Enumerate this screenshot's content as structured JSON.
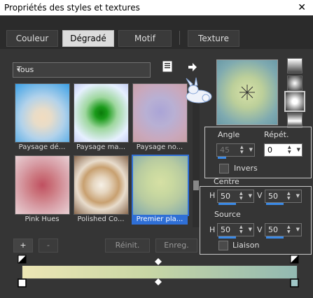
{
  "window": {
    "title": "Propriétés des styles et textures",
    "close": "✕"
  },
  "tabs": [
    "Couleur",
    "Dégradé",
    "Motif",
    "Texture"
  ],
  "dropdown": {
    "value": "Tous",
    "arrow": "▾"
  },
  "thumbnails": [
    {
      "label": "Paysage dé...",
      "colors": [
        "#f1dcc0",
        "#b2d2ea",
        "#3aa0e6"
      ]
    },
    {
      "label": "Paysage ma...",
      "colors": [
        "#118811",
        "#9ed79e",
        "#e6f0ff"
      ]
    },
    {
      "label": "Paysage no...",
      "colors": [
        "#aaa4d6",
        "#c0b0cc",
        "#c9a0a6"
      ]
    },
    {
      "label": "Pink Hues",
      "colors": [
        "#c05060",
        "#d8a0a8",
        "#e8d0d4"
      ]
    },
    {
      "label": "Polished Co...",
      "colors": [
        "#f6f0e6",
        "#c8a070",
        "#8a6a50"
      ]
    },
    {
      "label": "Premier pla...",
      "colors": [
        "#d6e0a4",
        "#b8cba0",
        "#7fa8ae"
      ]
    }
  ],
  "list_buttons": {
    "add": "+",
    "remove": "-",
    "reset": "Réinit.",
    "save": "Enreg."
  },
  "angle": {
    "label": "Angle",
    "value": "45"
  },
  "repeat": {
    "label": "Répét.",
    "value": "0"
  },
  "invert": {
    "label": "Invers"
  },
  "centre": {
    "label": "Centre",
    "h_label": "H",
    "h": "50",
    "v_label": "V",
    "v": "50"
  },
  "source": {
    "label": "Source",
    "h_label": "H",
    "h": "50",
    "v_label": "V",
    "v": "50"
  },
  "link": {
    "label": "Liaison"
  },
  "gradient_colors": [
    "#ede6b5",
    "#c9d7a5",
    "#92b9b2"
  ]
}
